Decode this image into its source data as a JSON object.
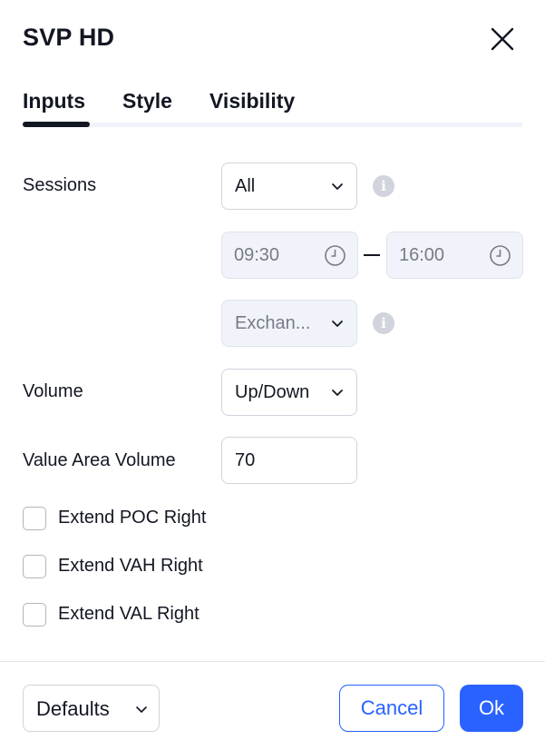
{
  "dialog": {
    "title": "SVP HD"
  },
  "tabs": [
    {
      "label": "Inputs",
      "active": true
    },
    {
      "label": "Style",
      "active": false
    },
    {
      "label": "Visibility",
      "active": false
    }
  ],
  "inputs": {
    "sessions": {
      "label": "Sessions",
      "value": "All"
    },
    "session_time": {
      "start": "09:30",
      "end": "16:00"
    },
    "timezone": {
      "value": "Exchan..."
    },
    "volume": {
      "label": "Volume",
      "value": "Up/Down"
    },
    "value_area_volume": {
      "label": "Value Area Volume",
      "value": "70"
    },
    "checkboxes": [
      {
        "label": "Extend POC Right",
        "checked": false
      },
      {
        "label": "Extend VAH Right",
        "checked": false
      },
      {
        "label": "Extend VAL Right",
        "checked": false
      }
    ]
  },
  "footer": {
    "defaults_label": "Defaults",
    "cancel_label": "Cancel",
    "ok_label": "Ok"
  },
  "colors": {
    "accent": "#2962ff",
    "text": "#131722",
    "muted": "#787b86",
    "border": "#d1d4dc",
    "disabled_bg": "#f0f3fa"
  },
  "icons": {
    "close": "close-icon",
    "chevron": "chevron-down-icon",
    "info": "info-icon",
    "clock": "clock-icon"
  }
}
